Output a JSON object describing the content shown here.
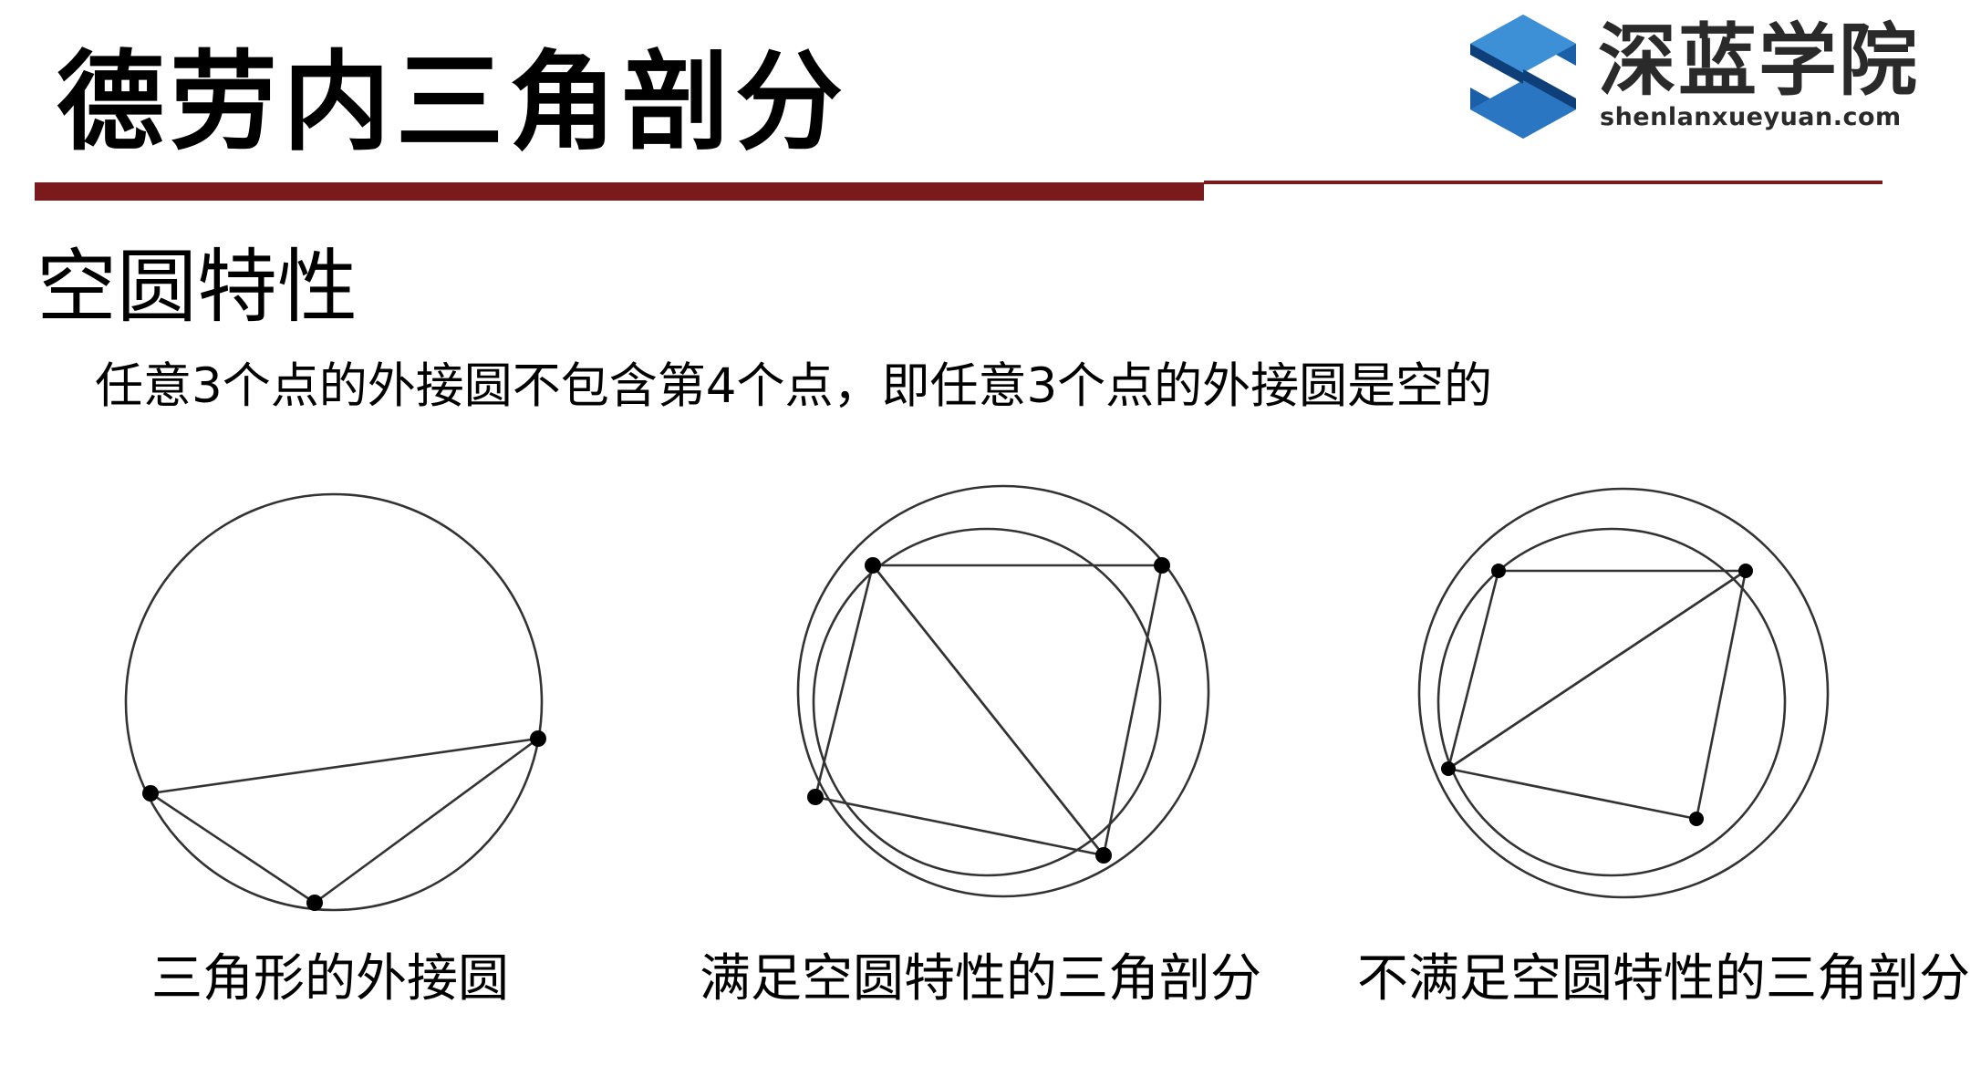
{
  "slide": {
    "title": "德劳内三角剖分",
    "subtitle": "空圆特性",
    "description": "任意3个点的外接圆不包含第4个点，即任意3个点的外接圆是空的"
  },
  "logo": {
    "name": "深蓝学院",
    "url": "shenlanxueyuan.com",
    "colors": {
      "primary": "#1a5fa8",
      "light": "#3d8fd6",
      "dark": "#0e3f78"
    }
  },
  "accent_color": "#7b1a1d",
  "diagrams": [
    {
      "caption": "三角形的外接圆"
    },
    {
      "caption": "满足空圆特性的三角剖分"
    },
    {
      "caption": "不满足空圆特性的三角剖分"
    }
  ]
}
